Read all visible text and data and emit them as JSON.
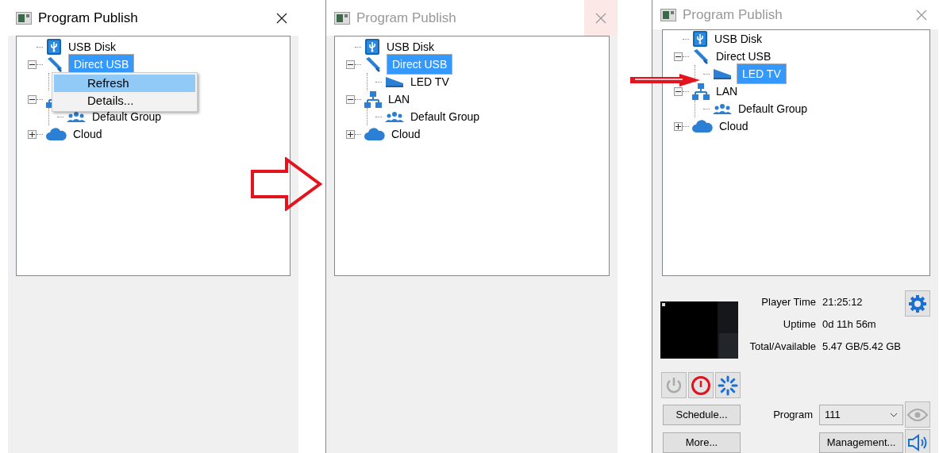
{
  "panels": [
    {
      "title": "Program Publish",
      "active": true,
      "close_hover": false,
      "tree": [
        {
          "kind": "usb-disk",
          "label": "USB Disk",
          "selected": false
        },
        {
          "kind": "usb-stick",
          "label": "Direct USB",
          "selected": true,
          "expanded": true,
          "children": [
            {
              "covered": true
            }
          ]
        },
        {
          "kind": "lan",
          "expanded": true,
          "children": [
            {
              "kind": "group",
              "label": "Default Group",
              "selected": false
            }
          ]
        },
        {
          "kind": "cloud",
          "label": "Cloud",
          "selected": false,
          "expanded": false
        }
      ],
      "context_menu": [
        {
          "label": "Refresh",
          "selected": true
        },
        {
          "label": "Details...",
          "selected": false
        }
      ]
    },
    {
      "title": "Program Publish",
      "active": false,
      "close_hover": true,
      "tree": [
        {
          "kind": "usb-disk",
          "label": "USB Disk",
          "selected": false
        },
        {
          "kind": "usb-stick",
          "label": "Direct USB",
          "selected": true,
          "expanded": true,
          "children": [
            {
              "kind": "tv",
              "label": "LED TV",
              "selected": false
            }
          ]
        },
        {
          "kind": "lan",
          "label": "LAN",
          "selected": false,
          "expanded": true,
          "children": [
            {
              "kind": "group",
              "label": "Default Group",
              "selected": false
            }
          ]
        },
        {
          "kind": "cloud",
          "label": "Cloud",
          "selected": false,
          "expanded": false
        }
      ]
    },
    {
      "title": "Program Publish",
      "active": false,
      "close_hover": false,
      "tree": [
        {
          "kind": "usb-disk",
          "label": "USB Disk",
          "selected": false
        },
        {
          "kind": "usb-stick",
          "label": "Direct USB",
          "selected": false,
          "expanded": true,
          "children": [
            {
              "kind": "tv",
              "label": "LED TV",
              "selected": true
            }
          ]
        },
        {
          "kind": "lan",
          "label": "LAN",
          "selected": false,
          "expanded": true,
          "children": [
            {
              "kind": "group",
              "label": "Default Group",
              "selected": false
            }
          ]
        },
        {
          "kind": "cloud",
          "label": "Cloud",
          "selected": false,
          "expanded": false
        }
      ],
      "device": {
        "info": [
          {
            "label": "Player Time",
            "value": "21:25:12"
          },
          {
            "label": "Uptime",
            "value": "0d 11h 56m"
          },
          {
            "label": "Total/Available",
            "value": "5.47 GB/5.42 GB"
          }
        ],
        "power_buttons": [
          {
            "kind": "power",
            "disabled": true
          },
          {
            "kind": "shutdown",
            "disabled": false
          },
          {
            "kind": "restart",
            "disabled": false
          }
        ],
        "schedule_button": "Schedule...",
        "more_button": "More...",
        "program_label": "Program",
        "program_value": "111",
        "preview_disabled": true,
        "management_button": "Management..."
      }
    }
  ]
}
